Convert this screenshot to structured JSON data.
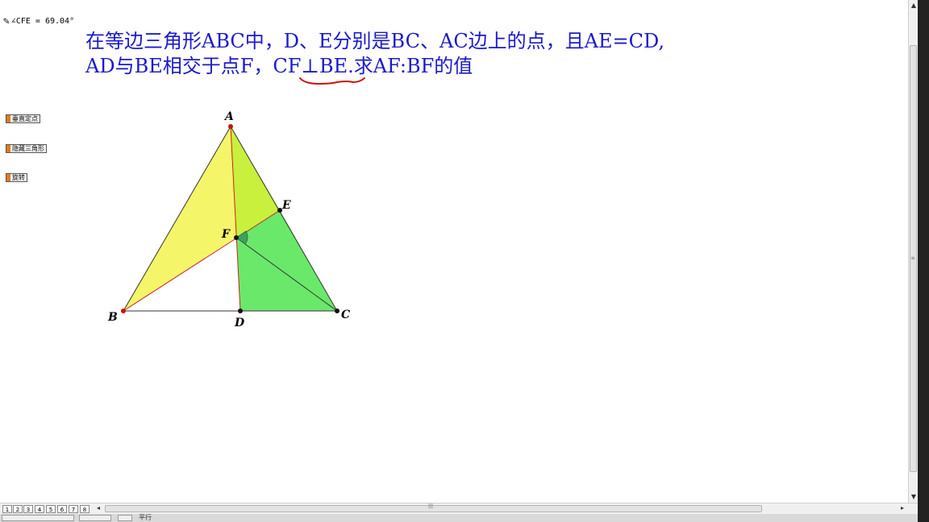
{
  "measurement": {
    "icon": "pen-icon",
    "text": "∠CFE = 69.04°"
  },
  "problem": {
    "line1": "在等边三角形ABC中，D、E分别是BC、AC边上的点，且AE=CD,",
    "line2_pre": "AD与BE相交于点F，",
    "line2_highlight": "CF⊥BE.",
    "line2_post": "求AF:BF的值"
  },
  "buttons": [
    {
      "label": "垂直定点"
    },
    {
      "label": "隐藏三角形"
    },
    {
      "label": "旋转"
    }
  ],
  "points": {
    "A": "A",
    "B": "B",
    "C": "C",
    "D": "D",
    "E": "E",
    "F": "F"
  },
  "colors": {
    "text_blue": "#1a1acc",
    "annotation_red": "#cc1111",
    "fill_yellow": "#f5f56a",
    "fill_yellowgreen": "#c8f03c",
    "fill_green": "#6ae86a",
    "button_orange": "#e07a1f"
  },
  "page_tabs": [
    "1",
    "2",
    "3",
    "4",
    "5",
    "6",
    "7",
    "8"
  ],
  "status": {
    "text": "平行"
  }
}
